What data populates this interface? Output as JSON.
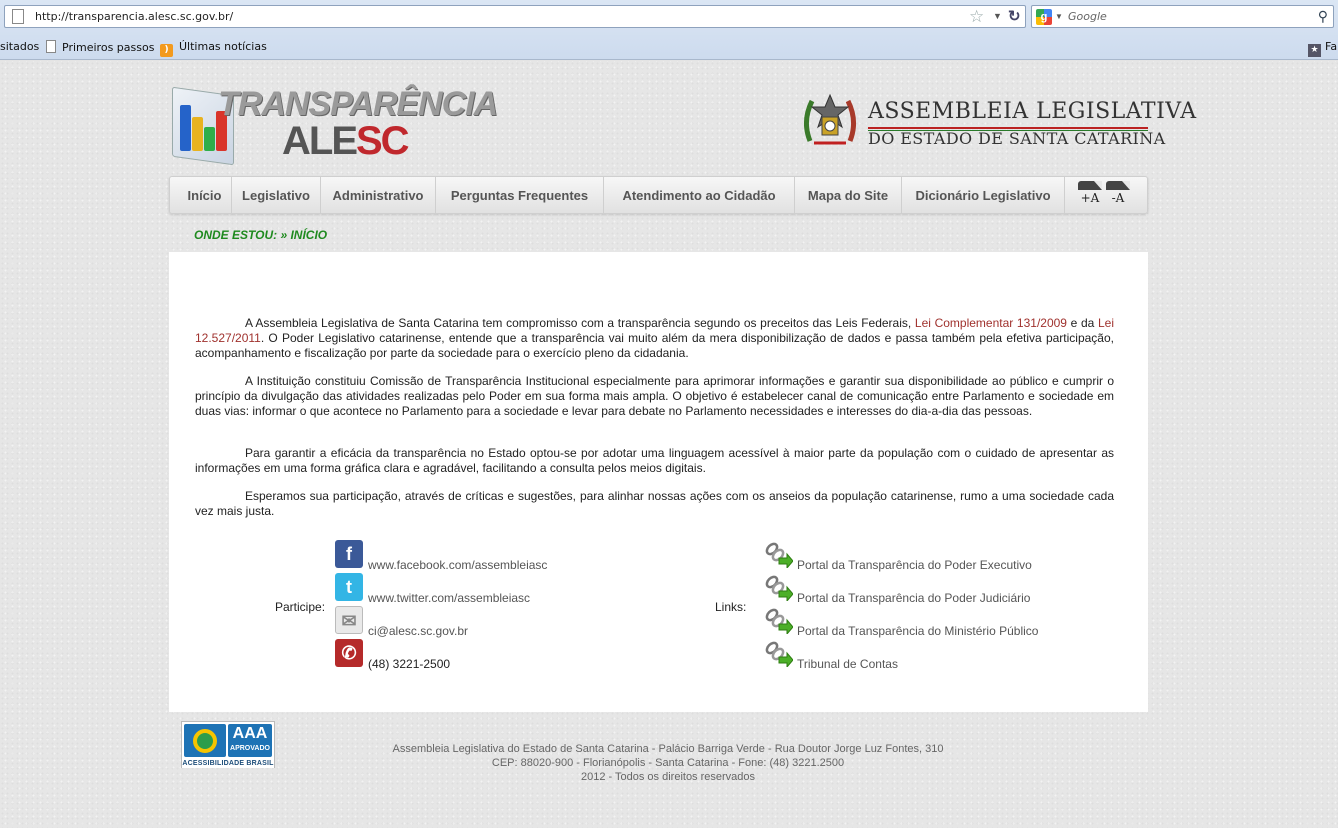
{
  "browser": {
    "url": "http://transparencia.alesc.sc.gov.br/",
    "search_placeholder": "Google",
    "bookmarks": [
      "sitados",
      "Primeiros passos",
      "Últimas notícias",
      "Fa"
    ]
  },
  "header": {
    "logo_title": "TRANSPARÊNCIA",
    "logo_sub_a": "ALE",
    "logo_sub_b": "SC",
    "assembleia_name": "ASSEMBLEIA LEGISLATIVA",
    "assembleia_sub": "DO ESTADO DE SANTA CATARINA"
  },
  "nav": {
    "items": [
      "Início",
      "Legislativo",
      "Administrativo",
      "Perguntas Frequentes",
      "Atendimento ao Cidadão",
      "Mapa do Site",
      "Dicionário Legislativo"
    ],
    "font_increase": "+A",
    "font_decrease": "-A"
  },
  "breadcrumb": "ONDE ESTOU: » INÍCIO",
  "content": {
    "p1_a": "A Assembleia Legislativa de Santa Catarina tem compromisso com a transparência segundo os preceitos das Leis Federais, ",
    "p1_link1": "Lei Complementar 131/2009",
    "p1_b": " e da ",
    "p1_link2": "Lei 12.527/2011",
    "p1_c": ". O Poder Legislativo catarinense, entende que a transparência vai muito além da mera disponibilização de dados e passa também pela efetiva participação, acompanhamento e fiscalização por parte da sociedade para o exercício pleno da cidadania.",
    "p2": "A Instituição constituiu Comissão de Transparência Institucional especialmente para aprimorar informações e garantir sua disponibilidade ao público e cumprir o princípio da divulgação das atividades realizadas pelo Poder em sua forma mais ampla. O objetivo é estabelecer canal de comunicação entre Parlamento e sociedade em duas vias: informar o que acontece no Parlamento para a sociedade e levar para debate no Parlamento necessidades e interesses do dia-a-dia das pessoas.",
    "p3": "Para garantir a eficácia da transparência no Estado optou-se por adotar uma linguagem acessível à maior parte da população com o cuidado de apresentar as informações em uma forma gráfica clara e agradável, facilitando a consulta pelos meios digitais.",
    "p4": "Esperamos sua participação, através de críticas e sugestões, para alinhar nossas ações com os anseios da população catarinense, rumo a uma sociedade cada vez mais justa.",
    "participe_label": "Participe:",
    "social": {
      "facebook": "www.facebook.com/assembleiasc",
      "twitter": "www.twitter.com/assembleiasc",
      "email": "ci@alesc.sc.gov.br",
      "phone": "(48) 3221-2500"
    },
    "links_label": "Links:",
    "links": [
      "Portal da Transparência do Poder Executivo",
      "Portal da Transparência do Poder Judiciário",
      "Portal da Transparência do Ministério Público",
      "Tribunal de Contas"
    ]
  },
  "footer": {
    "badge_aaa": "AAA",
    "badge_aprovado": "APROVADO",
    "badge_bottom": "ACESSIBILIDADE BRASIL",
    "line1": "Assembleia Legislativa do Estado de Santa Catarina - Palácio Barriga Verde - Rua Doutor Jorge Luz Fontes, 310",
    "line2": "CEP: 88020-900 - Florianópolis - Santa Catarina - Fone: (48) 3221.2500",
    "line3": "2012 - Todos os direitos reservados"
  }
}
